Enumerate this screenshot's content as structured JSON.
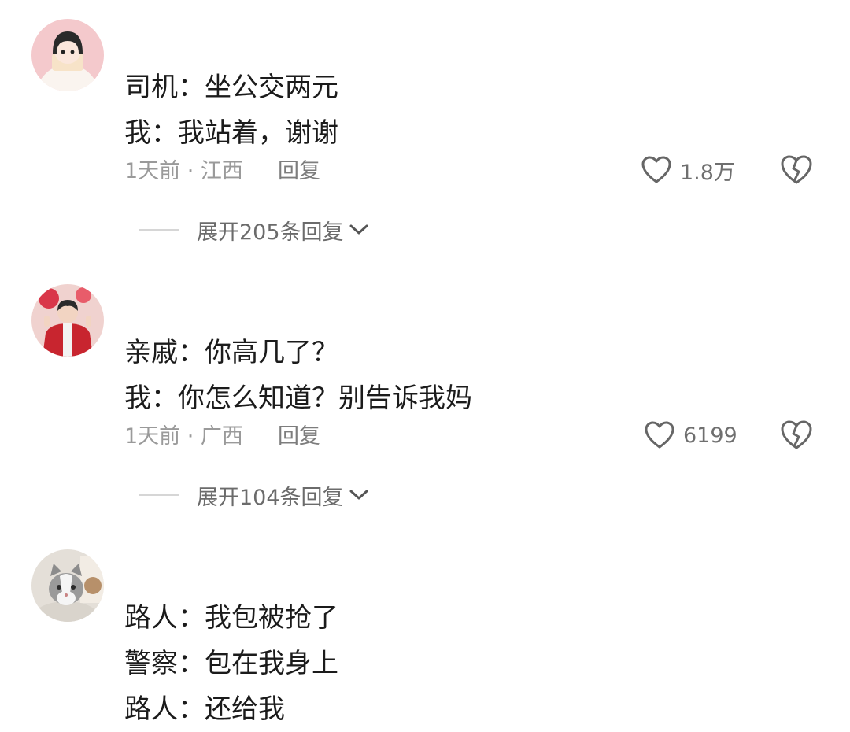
{
  "comments": [
    {
      "avatar_icon": "anime-girl-avatar-icon",
      "lines": [
        "司机：坐公交两元",
        "我：我站着，谢谢"
      ],
      "meta": "1天前 · 江西",
      "reply_label": "回复",
      "likes": "1.8万",
      "expand_label": "展开205条回复"
    },
    {
      "avatar_icon": "person-red-jacket-avatar-icon",
      "lines": [
        "亲戚：你高几了？",
        "我：你怎么知道？别告诉我妈"
      ],
      "meta": "1天前 · 广西",
      "reply_label": "回复",
      "likes": "6199",
      "expand_label": "展开104条回复"
    },
    {
      "avatar_icon": "cat-avatar-icon",
      "lines": [
        "路人：我包被抢了",
        "警察：包在我身上",
        "路人：还给我"
      ]
    }
  ],
  "icons": {
    "like": "heart-outline-icon",
    "dislike": "broken-heart-icon",
    "expand": "chevron-down-icon"
  },
  "colors": {
    "text": "#1b1b1b",
    "meta": "#9a9a9a",
    "icon": "#666666"
  }
}
